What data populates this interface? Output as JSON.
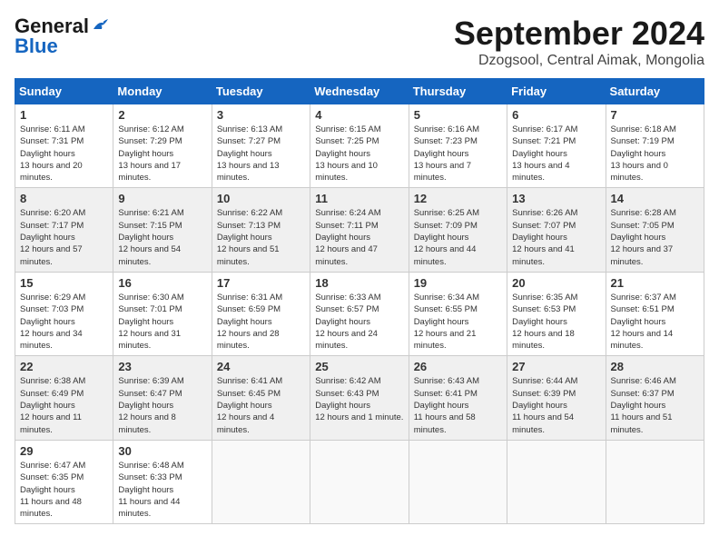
{
  "header": {
    "logo_line1": "General",
    "logo_line2": "Blue",
    "month_title": "September 2024",
    "location": "Dzogsool, Central Aimak, Mongolia"
  },
  "days_of_week": [
    "Sunday",
    "Monday",
    "Tuesday",
    "Wednesday",
    "Thursday",
    "Friday",
    "Saturday"
  ],
  "weeks": [
    [
      {
        "day": "1",
        "sunrise": "6:11 AM",
        "sunset": "7:31 PM",
        "daylight": "13 hours and 20 minutes."
      },
      {
        "day": "2",
        "sunrise": "6:12 AM",
        "sunset": "7:29 PM",
        "daylight": "13 hours and 17 minutes."
      },
      {
        "day": "3",
        "sunrise": "6:13 AM",
        "sunset": "7:27 PM",
        "daylight": "13 hours and 13 minutes."
      },
      {
        "day": "4",
        "sunrise": "6:15 AM",
        "sunset": "7:25 PM",
        "daylight": "13 hours and 10 minutes."
      },
      {
        "day": "5",
        "sunrise": "6:16 AM",
        "sunset": "7:23 PM",
        "daylight": "13 hours and 7 minutes."
      },
      {
        "day": "6",
        "sunrise": "6:17 AM",
        "sunset": "7:21 PM",
        "daylight": "13 hours and 4 minutes."
      },
      {
        "day": "7",
        "sunrise": "6:18 AM",
        "sunset": "7:19 PM",
        "daylight": "13 hours and 0 minutes."
      }
    ],
    [
      {
        "day": "8",
        "sunrise": "6:20 AM",
        "sunset": "7:17 PM",
        "daylight": "12 hours and 57 minutes."
      },
      {
        "day": "9",
        "sunrise": "6:21 AM",
        "sunset": "7:15 PM",
        "daylight": "12 hours and 54 minutes."
      },
      {
        "day": "10",
        "sunrise": "6:22 AM",
        "sunset": "7:13 PM",
        "daylight": "12 hours and 51 minutes."
      },
      {
        "day": "11",
        "sunrise": "6:24 AM",
        "sunset": "7:11 PM",
        "daylight": "12 hours and 47 minutes."
      },
      {
        "day": "12",
        "sunrise": "6:25 AM",
        "sunset": "7:09 PM",
        "daylight": "12 hours and 44 minutes."
      },
      {
        "day": "13",
        "sunrise": "6:26 AM",
        "sunset": "7:07 PM",
        "daylight": "12 hours and 41 minutes."
      },
      {
        "day": "14",
        "sunrise": "6:28 AM",
        "sunset": "7:05 PM",
        "daylight": "12 hours and 37 minutes."
      }
    ],
    [
      {
        "day": "15",
        "sunrise": "6:29 AM",
        "sunset": "7:03 PM",
        "daylight": "12 hours and 34 minutes."
      },
      {
        "day": "16",
        "sunrise": "6:30 AM",
        "sunset": "7:01 PM",
        "daylight": "12 hours and 31 minutes."
      },
      {
        "day": "17",
        "sunrise": "6:31 AM",
        "sunset": "6:59 PM",
        "daylight": "12 hours and 28 minutes."
      },
      {
        "day": "18",
        "sunrise": "6:33 AM",
        "sunset": "6:57 PM",
        "daylight": "12 hours and 24 minutes."
      },
      {
        "day": "19",
        "sunrise": "6:34 AM",
        "sunset": "6:55 PM",
        "daylight": "12 hours and 21 minutes."
      },
      {
        "day": "20",
        "sunrise": "6:35 AM",
        "sunset": "6:53 PM",
        "daylight": "12 hours and 18 minutes."
      },
      {
        "day": "21",
        "sunrise": "6:37 AM",
        "sunset": "6:51 PM",
        "daylight": "12 hours and 14 minutes."
      }
    ],
    [
      {
        "day": "22",
        "sunrise": "6:38 AM",
        "sunset": "6:49 PM",
        "daylight": "12 hours and 11 minutes."
      },
      {
        "day": "23",
        "sunrise": "6:39 AM",
        "sunset": "6:47 PM",
        "daylight": "12 hours and 8 minutes."
      },
      {
        "day": "24",
        "sunrise": "6:41 AM",
        "sunset": "6:45 PM",
        "daylight": "12 hours and 4 minutes."
      },
      {
        "day": "25",
        "sunrise": "6:42 AM",
        "sunset": "6:43 PM",
        "daylight": "12 hours and 1 minute."
      },
      {
        "day": "26",
        "sunrise": "6:43 AM",
        "sunset": "6:41 PM",
        "daylight": "11 hours and 58 minutes."
      },
      {
        "day": "27",
        "sunrise": "6:44 AM",
        "sunset": "6:39 PM",
        "daylight": "11 hours and 54 minutes."
      },
      {
        "day": "28",
        "sunrise": "6:46 AM",
        "sunset": "6:37 PM",
        "daylight": "11 hours and 51 minutes."
      }
    ],
    [
      {
        "day": "29",
        "sunrise": "6:47 AM",
        "sunset": "6:35 PM",
        "daylight": "11 hours and 48 minutes."
      },
      {
        "day": "30",
        "sunrise": "6:48 AM",
        "sunset": "6:33 PM",
        "daylight": "11 hours and 44 minutes."
      },
      null,
      null,
      null,
      null,
      null
    ]
  ]
}
